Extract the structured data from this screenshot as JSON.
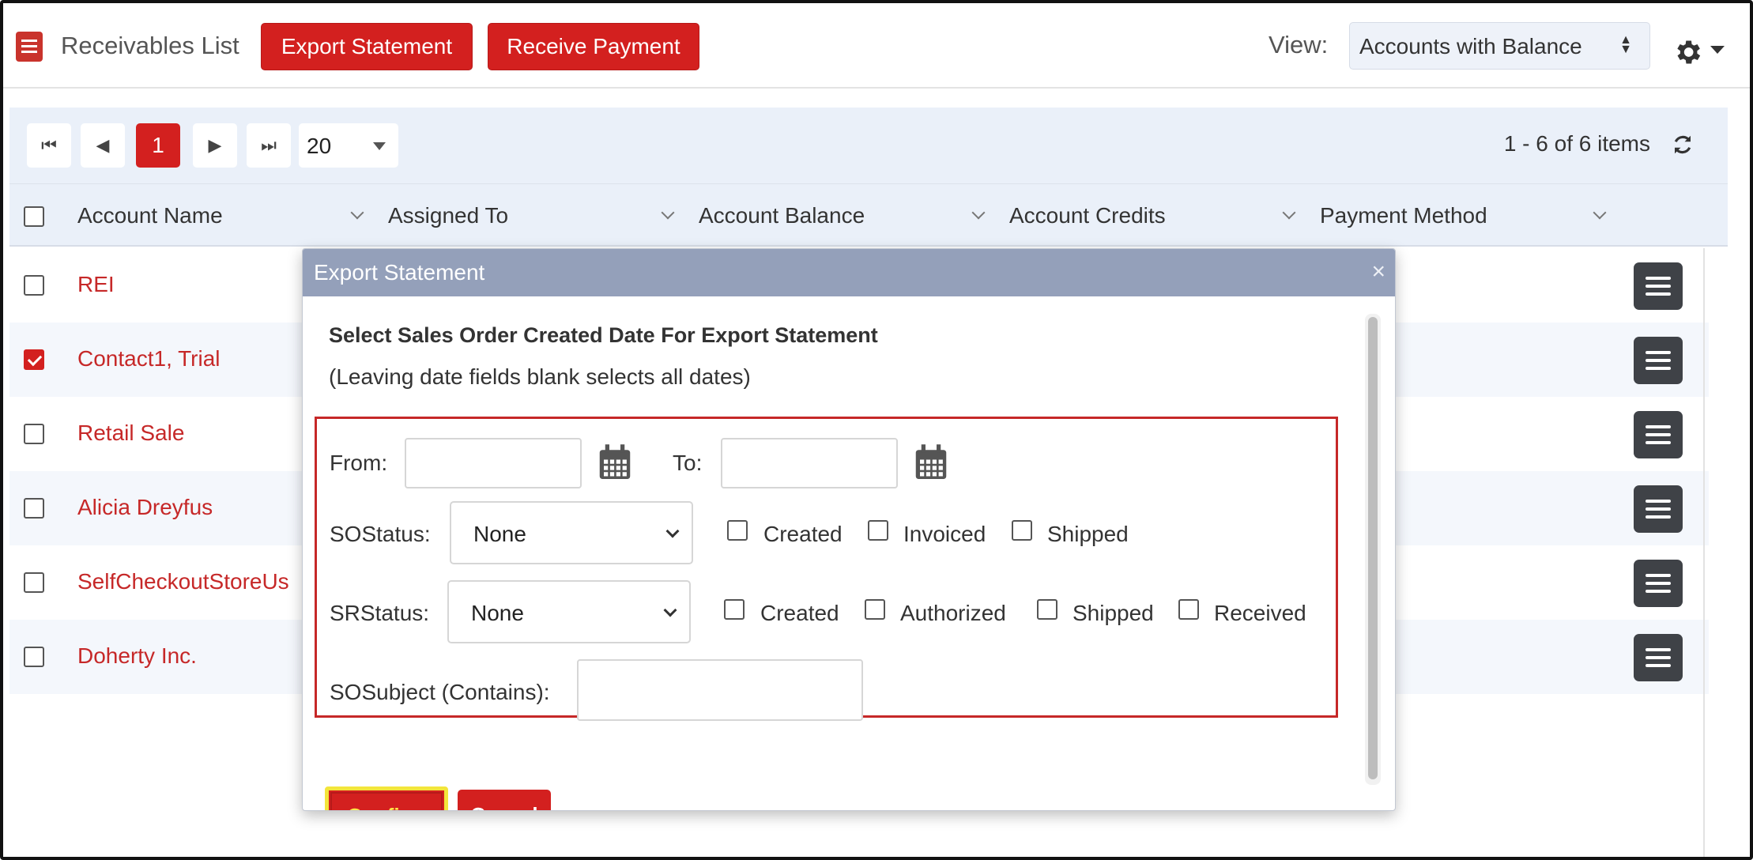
{
  "header": {
    "title": "Receivables List",
    "export_label": "Export Statement",
    "receive_label": "Receive Payment",
    "view_label": "View:",
    "view_value": "Accounts with Balance"
  },
  "pager": {
    "current_page": "1",
    "page_size": "20",
    "info": "1 - 6 of 6 items"
  },
  "columns": [
    "Account Name",
    "Assigned To",
    "Account Balance",
    "Account Credits",
    "Payment Method"
  ],
  "rows": [
    {
      "name": "REI",
      "checked": false
    },
    {
      "name": "Contact1, Trial",
      "checked": true
    },
    {
      "name": "Retail Sale",
      "checked": false
    },
    {
      "name": "Alicia Dreyfus",
      "checked": false
    },
    {
      "name": "SelfCheckoutStoreUs",
      "checked": false
    },
    {
      "name": "Doherty Inc.",
      "checked": false
    }
  ],
  "dialog": {
    "title": "Export Statement",
    "close": "×",
    "heading": "Select Sales Order Created Date For Export Statement",
    "subheading": "(Leaving date fields blank selects all dates)",
    "from_label": "From:",
    "from_value": "",
    "to_label": "To:",
    "to_value": "",
    "so_status_label": "SOStatus:",
    "so_status_value": "None",
    "so_checks": [
      "Created",
      "Invoiced",
      "Shipped"
    ],
    "sr_status_label": "SRStatus:",
    "sr_status_value": "None",
    "sr_checks": [
      "Created",
      "Authorized",
      "Shipped",
      "Received"
    ],
    "subject_label": "SOSubject (Contains):",
    "subject_value": "",
    "confirm_label": "Confirm",
    "cancel_label": "Cancel"
  },
  "colors": {
    "accent_red": "#d3201f",
    "link_red": "#c62828",
    "dialog_title_bg": "#94a0ba",
    "confirm_highlight": "#f3e53b",
    "grid_header_bg": "#eaf0f9"
  },
  "icons": [
    "receivables-book-icon",
    "gear-icon",
    "first-page-icon",
    "prev-page-icon",
    "next-page-icon",
    "last-page-icon",
    "refresh-icon",
    "calendar-icon",
    "row-menu-icon",
    "close-icon"
  ]
}
